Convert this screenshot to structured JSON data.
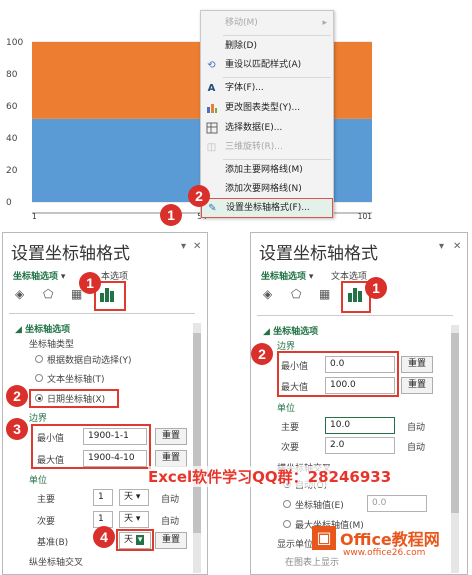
{
  "chart_data": {
    "type": "bar",
    "y_ticks": [
      "100",
      "80",
      "60",
      "40",
      "20",
      "0"
    ],
    "ylim": [
      0,
      100
    ],
    "x_tick_labels": [
      "1",
      "54",
      "101"
    ],
    "series": [
      {
        "values": [
          52
        ],
        "color": "#5b9bd5"
      },
      {
        "values": [
          48
        ],
        "color": "#ed7d31"
      }
    ]
  },
  "context_menu": {
    "items": [
      {
        "label": "移动(M)",
        "icon": "",
        "arrow": "▸",
        "disabled": true
      },
      {
        "label": "删除(D)",
        "icon": "",
        "disabled": false
      },
      {
        "label": "重设以匹配样式(A)",
        "icon": "reset-style-icon",
        "disabled": false
      },
      {
        "label": "字体(F)...",
        "icon": "font-icon",
        "disabled": false
      },
      {
        "label": "更改图表类型(Y)...",
        "icon": "chart-type-icon",
        "disabled": false
      },
      {
        "label": "选择数据(E)...",
        "icon": "select-data-icon",
        "disabled": false
      },
      {
        "label": "三维旋转(R)...",
        "icon": "3d-rotate-icon",
        "disabled": true
      },
      {
        "label": "添加主要网格线(M)",
        "icon": "",
        "disabled": false
      },
      {
        "label": "添加次要网格线(N)",
        "icon": "",
        "disabled": false
      },
      {
        "label": "设置坐标轴格式(F)...",
        "icon": "format-axis-icon",
        "disabled": false,
        "highlighted": true
      }
    ]
  },
  "badges": {
    "b1": "1",
    "b2": "2",
    "b3": "3",
    "b4": "4"
  },
  "left_panel": {
    "title": "设置坐标轴格式",
    "tab_axis": "坐标轴选项",
    "tab_text": "本选项",
    "section": "坐标轴选项",
    "axis_type_label": "坐标轴类型",
    "radio_auto": "根据数据自动选择(Y)",
    "radio_text": "文本坐标轴(T)",
    "radio_date": "日期坐标轴(X)",
    "bounds_label": "边界",
    "min_label": "最小值",
    "min_value": "1900-1-1",
    "max_label": "最大值",
    "max_value": "1900-4-10",
    "reset": "重置",
    "units_label": "单位",
    "major_label": "主要",
    "major_value": "1",
    "major_unit": "天",
    "auto": "自动",
    "minor_label": "次要",
    "minor_value": "1",
    "minor_unit": "天",
    "base_label": "基准(B)",
    "base_unit": "天",
    "cross_label": "纵坐标轴交叉"
  },
  "right_panel": {
    "title": "设置坐标轴格式",
    "tab_axis": "坐标轴选项",
    "tab_text": "文本选项",
    "section": "坐标轴选项",
    "bounds_label": "边界",
    "min_label": "最小值",
    "min_value": "0.0",
    "max_label": "最大值",
    "max_value": "100.0",
    "reset": "重置",
    "units_label": "单位",
    "major_label": "主要",
    "major_value": "10.0",
    "minor_label": "次要",
    "minor_value": "2.0",
    "auto": "自动",
    "cross_label": "横坐标轴交叉",
    "radio_auto": "自动(O)",
    "radio_value": "坐标轴值(E)",
    "cross_value": "0.0",
    "radio_max": "最大坐标轴值(M)",
    "display_units": "显示单位",
    "on_chart": "在图表上显示"
  },
  "watermark": "Excel软件学习QQ群：28246933",
  "logo": {
    "text": "Office教程网",
    "url": "www.office26.com"
  }
}
